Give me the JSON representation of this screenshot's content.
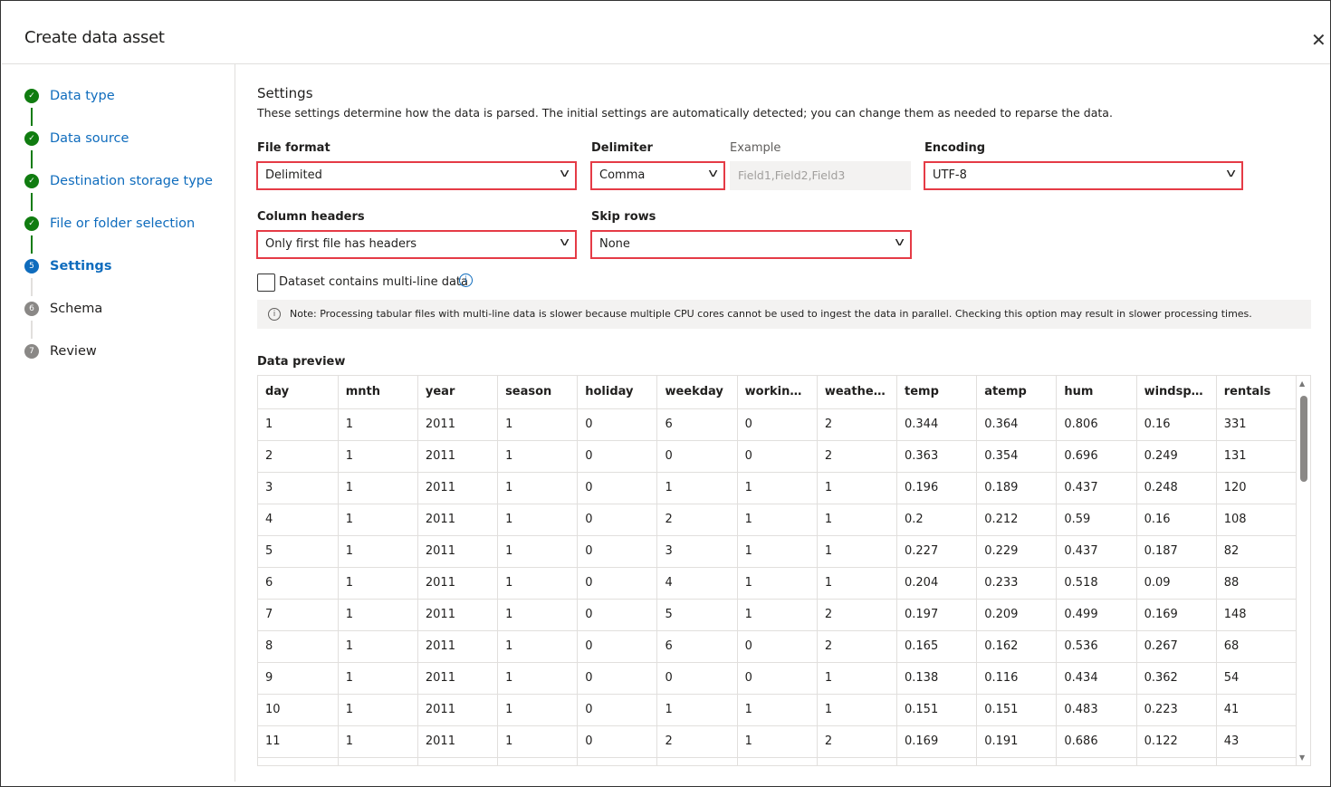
{
  "title": "Create data asset",
  "steps": [
    {
      "num": "1",
      "label": "Data type",
      "state": "done"
    },
    {
      "num": "2",
      "label": "Data source",
      "state": "done"
    },
    {
      "num": "3",
      "label": "Destination storage type",
      "state": "done"
    },
    {
      "num": "4",
      "label": "File or folder selection",
      "state": "done"
    },
    {
      "num": "5",
      "label": "Settings",
      "state": "current"
    },
    {
      "num": "6",
      "label": "Schema",
      "state": "todo"
    },
    {
      "num": "7",
      "label": "Review",
      "state": "todo"
    }
  ],
  "settings": {
    "heading": "Settings",
    "description": "These settings determine how the data is parsed. The initial settings are automatically detected; you can change them as needed to reparse the data.",
    "file_format": {
      "label": "File format",
      "value": "Delimited"
    },
    "delimiter": {
      "label": "Delimiter",
      "value": "Comma"
    },
    "example": {
      "label": "Example",
      "value": "Field1,Field2,Field3"
    },
    "encoding": {
      "label": "Encoding",
      "value": "UTF-8"
    },
    "column_headers": {
      "label": "Column headers",
      "value": "Only first file has headers"
    },
    "skip_rows": {
      "label": "Skip rows",
      "value": "None"
    },
    "multiline": {
      "label": "Dataset contains multi-line data",
      "checked": false
    },
    "note": "Note: Processing tabular files with multi-line data is slower because multiple CPU cores cannot be used to ingest the data in parallel. Checking this option may result in slower processing times."
  },
  "preview": {
    "label": "Data preview",
    "columns": [
      "day",
      "mnth",
      "year",
      "season",
      "holiday",
      "weekday",
      "working...",
      "weathersit",
      "temp",
      "atemp",
      "hum",
      "windspeed",
      "rentals"
    ],
    "rows": [
      [
        "1",
        "1",
        "2011",
        "1",
        "0",
        "6",
        "0",
        "2",
        "0.344",
        "0.364",
        "0.806",
        "0.16",
        "331"
      ],
      [
        "2",
        "1",
        "2011",
        "1",
        "0",
        "0",
        "0",
        "2",
        "0.363",
        "0.354",
        "0.696",
        "0.249",
        "131"
      ],
      [
        "3",
        "1",
        "2011",
        "1",
        "0",
        "1",
        "1",
        "1",
        "0.196",
        "0.189",
        "0.437",
        "0.248",
        "120"
      ],
      [
        "4",
        "1",
        "2011",
        "1",
        "0",
        "2",
        "1",
        "1",
        "0.2",
        "0.212",
        "0.59",
        "0.16",
        "108"
      ],
      [
        "5",
        "1",
        "2011",
        "1",
        "0",
        "3",
        "1",
        "1",
        "0.227",
        "0.229",
        "0.437",
        "0.187",
        "82"
      ],
      [
        "6",
        "1",
        "2011",
        "1",
        "0",
        "4",
        "1",
        "1",
        "0.204",
        "0.233",
        "0.518",
        "0.09",
        "88"
      ],
      [
        "7",
        "1",
        "2011",
        "1",
        "0",
        "5",
        "1",
        "2",
        "0.197",
        "0.209",
        "0.499",
        "0.169",
        "148"
      ],
      [
        "8",
        "1",
        "2011",
        "1",
        "0",
        "6",
        "0",
        "2",
        "0.165",
        "0.162",
        "0.536",
        "0.267",
        "68"
      ],
      [
        "9",
        "1",
        "2011",
        "1",
        "0",
        "0",
        "0",
        "1",
        "0.138",
        "0.116",
        "0.434",
        "0.362",
        "54"
      ],
      [
        "10",
        "1",
        "2011",
        "1",
        "0",
        "1",
        "1",
        "1",
        "0.151",
        "0.151",
        "0.483",
        "0.223",
        "41"
      ],
      [
        "11",
        "1",
        "2011",
        "1",
        "0",
        "2",
        "1",
        "2",
        "0.169",
        "0.191",
        "0.686",
        "0.122",
        "43"
      ],
      [
        "",
        "",
        "",
        "",
        "",
        "",
        "",
        "",
        "",
        "",
        "",
        "",
        ""
      ]
    ]
  },
  "colors": {
    "accent": "#0f6cbd",
    "done": "#107c10",
    "highlight": "#e53b46"
  }
}
